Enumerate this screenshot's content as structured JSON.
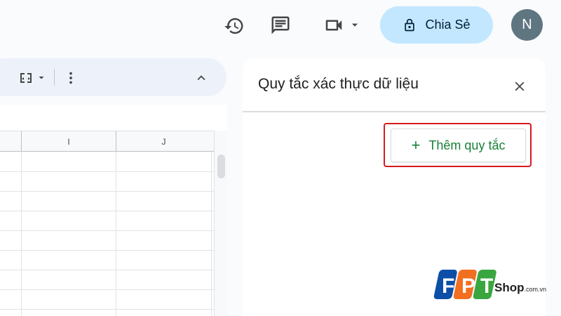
{
  "header": {
    "history_icon": "history-icon",
    "comments_icon": "comment-icon",
    "meet_icon": "video-camera-icon",
    "share_label": "Chia Sẻ",
    "avatar_letter": "N"
  },
  "toolbar": {
    "icons": [
      "split-columns-icon",
      "dropdown-icon",
      "more-vert-icon",
      "chevron-up-icon"
    ]
  },
  "sheet": {
    "columns": [
      "I",
      "J"
    ]
  },
  "panel": {
    "title": "Quy tắc xác thực dữ liệu",
    "add_rule_label": "Thêm quy tắc",
    "add_rule_icon": "+"
  },
  "watermark": {
    "brand": "FPT",
    "shop": "Shop",
    "domain": ".com.vn"
  },
  "colors": {
    "share_bg": "#c2e7ff",
    "accent_green": "#188038",
    "highlight_red": "#d71920",
    "fpt_blue": "#0d4fa8",
    "fpt_orange": "#f26f21",
    "fpt_green": "#3aa63f"
  }
}
